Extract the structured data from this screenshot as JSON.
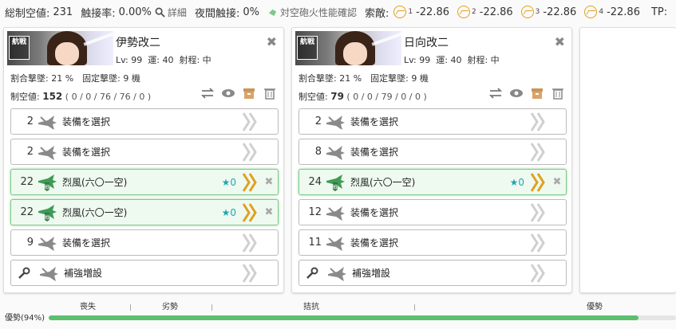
{
  "topbar": {
    "total_aa_label": "総制空値:",
    "total_aa_value": "231",
    "contact_label": "触接率:",
    "contact_value": "0.00%",
    "detail_label": "詳細",
    "night_contact_label": "夜間触接:",
    "night_contact_value": "0%",
    "aaci_label": "対空砲火性能確認",
    "los_label": "索敵:",
    "los": [
      {
        "sub": "1",
        "value": "-22.86"
      },
      {
        "sub": "2",
        "value": "-22.86"
      },
      {
        "sub": "3",
        "value": "-22.86"
      },
      {
        "sub": "4",
        "value": "-22.86"
      }
    ],
    "tp_label": "TP:"
  },
  "ships": [
    {
      "name": "伊勢改二",
      "banner_badge": "航戦",
      "lv": "Lv: 99",
      "luck": "運: 40",
      "range": "射程: 中",
      "atk_line": "割合撃墜: 21 %　固定撃墜: 9 機",
      "aa_label": "制空値:",
      "aa_value": "152",
      "aa_detail": "( 0 / 0 / 76 / 76 / 0 )",
      "slots": [
        {
          "count": "2",
          "name": "装備を選択",
          "equipped": false
        },
        {
          "count": "2",
          "name": "装備を選択",
          "equipped": false
        },
        {
          "count": "22",
          "name": "烈風(六〇一空)",
          "equipped": true,
          "star": "★0"
        },
        {
          "count": "22",
          "name": "烈風(六〇一空)",
          "equipped": true,
          "star": "★0"
        },
        {
          "count": "9",
          "name": "装備を選択",
          "equipped": false
        }
      ],
      "reinforce": "補強増設"
    },
    {
      "name": "日向改二",
      "banner_badge": "航戦",
      "lv": "Lv: 99",
      "luck": "運: 40",
      "range": "射程: 中",
      "atk_line": "割合撃墜: 21 %　固定撃墜: 9 機",
      "aa_label": "制空値:",
      "aa_value": "79",
      "aa_detail": "( 0 / 0 / 79 / 0 / 0 )",
      "slots": [
        {
          "count": "2",
          "name": "装備を選択",
          "equipped": false
        },
        {
          "count": "8",
          "name": "装備を選択",
          "equipped": false
        },
        {
          "count": "24",
          "name": "烈風(六〇一空)",
          "equipped": true,
          "star": "★0"
        },
        {
          "count": "12",
          "name": "装備を選択",
          "equipped": false
        },
        {
          "count": "11",
          "name": "装備を選択",
          "equipped": false
        }
      ],
      "reinforce": "補強増設"
    }
  ],
  "status_bar": {
    "current_label": "優勢(94%)",
    "progress": 0.94,
    "scale": [
      "喪失",
      "劣勢",
      "拮抗",
      "優勢"
    ]
  },
  "colors": {
    "equipped_bg": "#eefaf0",
    "equipped_border": "#7ec98a",
    "plane_green": "#3f9b55",
    "chevron_active": "#e0a020",
    "star": "#22a5b5",
    "bar_fill": "#5cbf6e"
  }
}
